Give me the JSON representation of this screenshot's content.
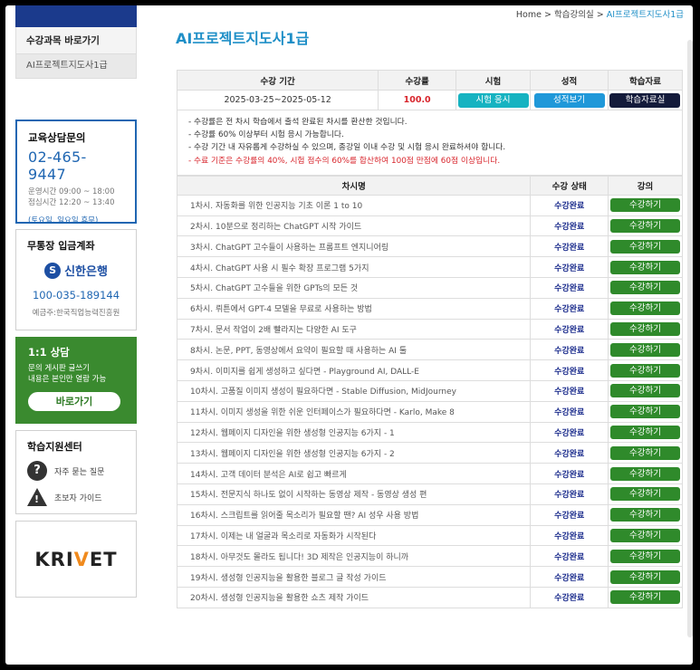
{
  "breadcrumb": {
    "home": "Home",
    "sep1": ">",
    "section": "학습강의실",
    "sep2": ">",
    "current": "AI프로젝트지도사1급"
  },
  "page_title": "AI프로젝트지도사1급",
  "sidebar": {
    "menu_title": "수강과목 바로가기",
    "menu_item": "AI프로젝트지도사1급",
    "contact": {
      "title": "교육상담문의",
      "phone": "02-465-9447",
      "hours_1": "운영시간 09:00 ~ 18:00",
      "hours_2": "점심시간 12:20 ~ 13:40",
      "holiday": "(토요일, 일요일 휴무)"
    },
    "bank": {
      "title": "무통장 입금계좌",
      "bank_name": "신한은행",
      "account": "100-035-189144",
      "holder": "예금주:한국직업능력진흥원"
    },
    "chat": {
      "title": "1:1 상담",
      "desc_1": "문의 게시판 글쓰기",
      "desc_2": "내용은 본인만 열람 가능",
      "button": "바로가기"
    },
    "support": {
      "title": "학습지원센터",
      "faq": "자주 묻는 질문",
      "guide": "초보자 가이드"
    },
    "logo": {
      "text_1": "KRI",
      "text_2": "V",
      "text_3": "ET"
    }
  },
  "summary": {
    "headers": [
      "수강 기간",
      "수강률",
      "시험",
      "성적",
      "학습자료"
    ],
    "period": "2025-03-25~2025-05-12",
    "rate": "100.0",
    "exam_btn": "시험 응시",
    "grade_btn": "성적보기",
    "material_btn": "학습자료실"
  },
  "notes": [
    "- 수강률은 전 차시 학습에서 출석 완료된 차시를 환산한 것입니다.",
    "- 수강률 60% 이상부터 시험 응시 가능합니다.",
    "- 수강 기간 내 자유롭게 수강하실 수 있으며, 종강일 이내 수강 및 시험 응시 완료하셔야 합니다.",
    "- 수료 기준은 수강률의 40%, 시험 점수의 60%를 합산하여 100점 만점에 60점 이상입니다."
  ],
  "lessons": {
    "headers": [
      "차시명",
      "수강 상태",
      "강의"
    ],
    "status_label": "수강완료",
    "button_label": "수강하기",
    "items": [
      "1차시. 자동화를 위한 인공지능 기초 이론 1 to 10",
      "2차시. 10분으로 정리하는 ChatGPT 시작 가이드",
      "3차시. ChatGPT 고수들이 사용하는 프롬프트 엔지니어링",
      "4차시. ChatGPT 사용 시 필수 확장 프로그램 5가지",
      "5차시. ChatGPT 고수들을 위한 GPTs의 모든 것",
      "6차시. 뤼튼에서 GPT-4 모델을 무료로 사용하는 방법",
      "7차시. 문서 작업이 2배 빨라지는 다양한 AI 도구",
      "8차시. 논문, PPT, 동영상에서 요약이 필요할 때 사용하는 AI 툴",
      "9차시. 이미지를 쉽게 생성하고 싶다면 - Playground AI, DALL-E",
      "10차시. 고품질 이미지 생성이 필요하다면 - Stable Diffusion, MidJourney",
      "11차시. 이미지 생성을 위한 쉬운 인터페이스가 필요하다면 - Karlo, Make 8",
      "12차시. 웹페이지 디자인을 위한 생성형 인공지능 6가지 - 1",
      "13차시. 웹페이지 디자인을 위한 생성형 인공지능 6가지 - 2",
      "14차시. 고객 데이터 분석은 AI로 쉽고 빠르게",
      "15차시. 전문지식 하나도 없이 시작하는 동영상 제작 - 동영상 생성 편",
      "16차시. 스크립트를 읽어줄 목소리가 필요할 땐? AI 성우 사용 방법",
      "17차시. 이제는 내 얼굴과 목소리로 자동화가 시작된다",
      "18차시. 아무것도 몰라도 됩니다! 3D 제작은 인공지능이 하니까",
      "19차시. 생성형 인공지능을 활용한 블로그 글 작성 가이드",
      "20차시. 생성형 인공지능을 활용한 쇼츠 제작 가이드"
    ]
  }
}
